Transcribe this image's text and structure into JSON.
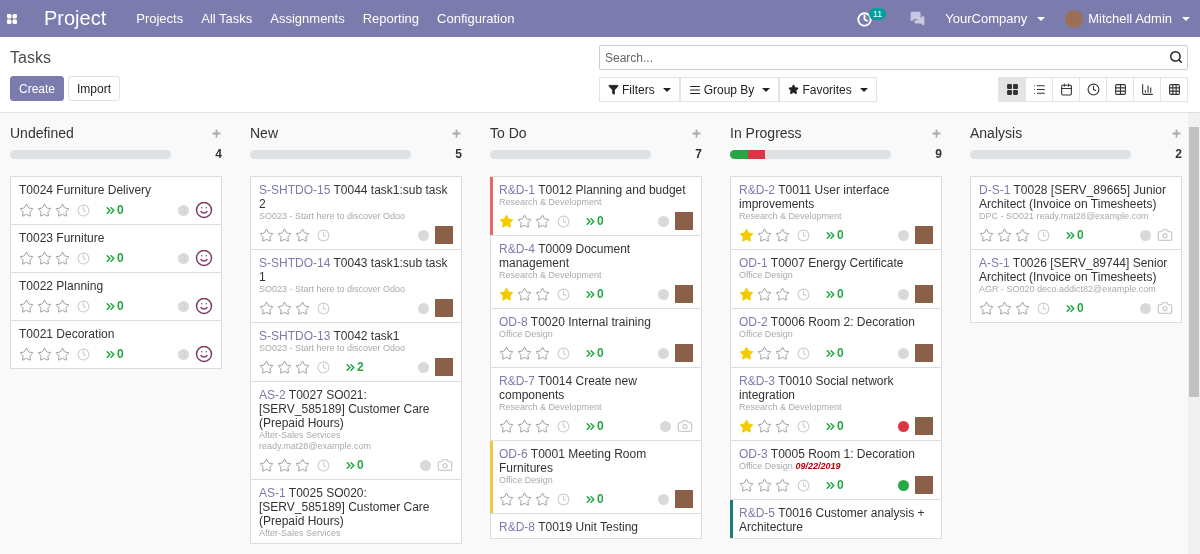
{
  "navbar": {
    "app_name": "Project",
    "menu": [
      "Projects",
      "All Tasks",
      "Assignments",
      "Reporting",
      "Configuration"
    ],
    "activity_count": "11",
    "company": "YourCompany",
    "user": "Mitchell Admin"
  },
  "control_panel": {
    "title": "Tasks",
    "buttons": [
      {
        "label": "Create",
        "kind": "primary"
      },
      {
        "label": "Import",
        "kind": "secondary"
      }
    ],
    "search": {
      "placeholder": "Search..."
    },
    "filters": [
      {
        "label": "Filters",
        "kind": "filter"
      },
      {
        "label": "Group By",
        "kind": "group"
      },
      {
        "label": "Favorites",
        "kind": "favorite"
      }
    ],
    "views": [
      {
        "kind": "kanban",
        "selected": true
      },
      {
        "kind": "list",
        "selected": false
      },
      {
        "kind": "calendar",
        "selected": false
      },
      {
        "kind": "activity",
        "selected": false
      },
      {
        "kind": "pivot",
        "selected": false
      },
      {
        "kind": "graph",
        "selected": false
      },
      {
        "kind": "grid",
        "selected": false
      }
    ]
  },
  "columns": [
    {
      "title": "Undefined",
      "count": "4",
      "cards": [
        {
          "title": "T0024 Furniture Delivery",
          "stars": 0,
          "subtasks": "0",
          "color": "#d9d9d9",
          "kind": "smiley"
        },
        {
          "title": "T0023 Furniture",
          "stars": 0,
          "subtasks": "0",
          "color": "#d9d9d9",
          "kind": "smiley"
        },
        {
          "title": "T0022 Planning",
          "stars": 0,
          "subtasks": "0",
          "color": "#d9d9d9",
          "kind": "smiley"
        },
        {
          "title": "T0021 Decoration",
          "stars": 0,
          "subtasks": "0",
          "color": "#d9d9d9",
          "kind": "smiley"
        }
      ]
    },
    {
      "title": "New",
      "count": "5",
      "cards": [
        {
          "ref": "S-SHTDO-15",
          "title": "T0044 task1:sub task 2",
          "subtitle": "SO023 - Start here to discover Odoo",
          "stars": 0,
          "color": "#d9d9d9",
          "kind": "photo"
        },
        {
          "ref": "S-SHTDO-14",
          "title": "T0043 task1:sub task 1",
          "subtitle": "SO023 - Start here to discover Odoo",
          "stars": 0,
          "color": "#d9d9d9",
          "kind": "photo"
        },
        {
          "ref": "S-SHTDO-13",
          "title": "T0042 task1",
          "subtitle": "SO023 - Start here to discover Odoo",
          "stars": 0,
          "subtasks": "2",
          "color": "#d9d9d9",
          "kind": "photo"
        },
        {
          "ref": "AS-2",
          "title": "T0027 SO021: [SERV_585189] Customer Care (Prepaid Hours)",
          "subtitle": "After-Sales Services",
          "extra": "ready.mat28@example.com",
          "stars": 0,
          "subtasks": "0",
          "color": "#d9d9d9",
          "kind": "camera"
        },
        {
          "ref": "AS-1",
          "title": "T0025 SO020: [SERV_585189] Customer Care (Prepaid Hours)",
          "subtitle": "After-Sales Services"
        }
      ]
    },
    {
      "title": "To Do",
      "count": "7",
      "cards": [
        {
          "ref": "R&D-1",
          "title": "T0012 Planning and budget",
          "subtitle": "Research & Development",
          "stars": 1,
          "subtasks": "0",
          "color": "#d9d9d9",
          "kind": "photo",
          "stripe": {
            "color": "#e46a6a"
          }
        },
        {
          "ref": "R&D-4",
          "title": "T0009 Document management",
          "subtitle": "Research & Development",
          "stars": 1,
          "subtasks": "0",
          "color": "#d9d9d9",
          "kind": "photo"
        },
        {
          "ref": "OD-8",
          "title": "T0020 Internal training",
          "subtitle": "Office Design",
          "stars": 0,
          "subtasks": "0",
          "color": "#d9d9d9",
          "kind": "photo"
        },
        {
          "ref": "R&D-7",
          "title": "T0014 Create new components",
          "subtitle": "Research & Development",
          "stars": 0,
          "subtasks": "0",
          "color": "#d9d9d9",
          "kind": "camera"
        },
        {
          "ref": "OD-6",
          "title": "T0001 Meeting Room Furnitures",
          "subtitle": "Office Design",
          "stars": 0,
          "subtasks": "0",
          "color": "#d9d9d9",
          "kind": "photo",
          "stripe": {
            "color": "#f0c93a"
          }
        },
        {
          "ref": "R&D-8",
          "title": "T0019 Unit Testing"
        }
      ]
    },
    {
      "title": "In Progress",
      "count": "9",
      "progress": [
        {
          "color": "#28a745",
          "level": 0.11
        },
        {
          "color": "#dc3545",
          "level": 0.11
        }
      ],
      "cards": [
        {
          "ref": "R&D-2",
          "title": "T0011 User interface improvements",
          "subtitle": "Research & Development",
          "stars": 1,
          "subtasks": "0",
          "color": "#d9d9d9",
          "kind": "photo"
        },
        {
          "ref": "OD-1",
          "title": "T0007 Energy Certificate",
          "subtitle": "Office Design",
          "stars": 1,
          "subtasks": "0",
          "color": "#d9d9d9",
          "kind": "photo"
        },
        {
          "ref": "OD-2",
          "title": "T0006 Room 2: Decoration",
          "subtitle": "Office Design",
          "stars": 1,
          "subtasks": "0",
          "color": "#d9d9d9",
          "kind": "photo"
        },
        {
          "ref": "R&D-3",
          "title": "T0010 Social network integration",
          "subtitle": "Research & Development",
          "stars": 1,
          "subtasks": "0",
          "color": "#dc3545",
          "kind": "photo"
        },
        {
          "ref": "OD-3",
          "title": "T0005 Room 1: Decoration",
          "subtitle": "Office Design",
          "date": "09/22/2019",
          "stars": 0,
          "subtasks": "0",
          "color": "#28a745",
          "kind": "photo"
        },
        {
          "ref": "R&D-5",
          "title": "T0016 Customer analysis + Architecture",
          "stripe": {
            "color": "#1f7a7a"
          }
        }
      ]
    },
    {
      "title": "Analysis",
      "count": "2",
      "cards": [
        {
          "ref": "D-S-1",
          "title": "T0028 [SERV_89665] Junior Architect (Invoice on Timesheets)",
          "subtitle": "DPC - SO021 ready.mat28@example.com",
          "stars": 0,
          "subtasks": "0",
          "color": "#d9d9d9",
          "kind": "camera"
        },
        {
          "ref": "A-S-1",
          "title": "T0026 [SERV_89744] Senior Architect (Invoice on Timesheets)",
          "subtitle": "AGR - SO020 deco.addict82@example.com",
          "stars": 0,
          "subtasks": "0",
          "color": "#d9d9d9",
          "kind": "camera"
        }
      ]
    }
  ]
}
